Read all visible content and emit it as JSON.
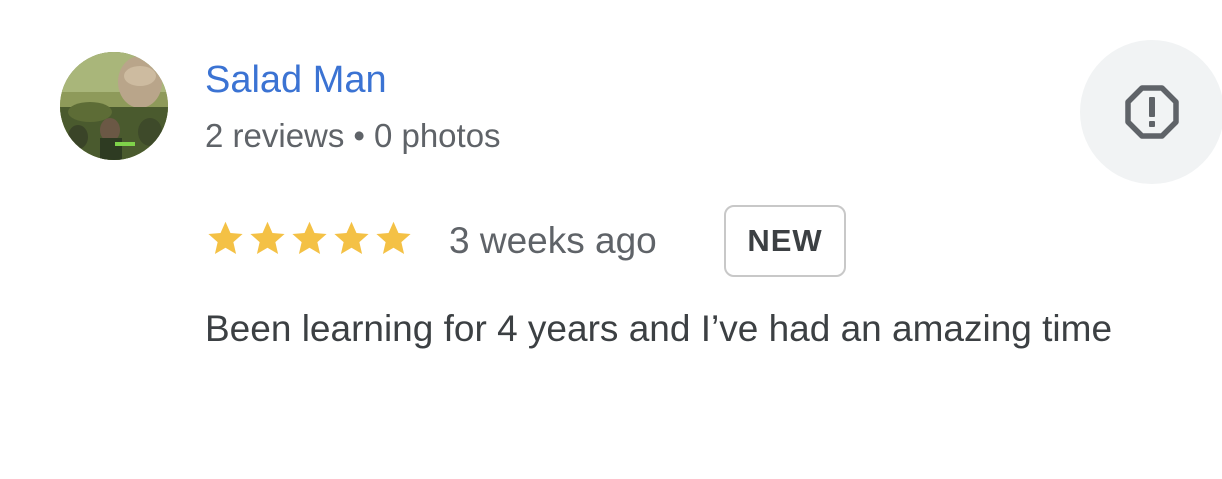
{
  "review": {
    "author": {
      "name": "Salad Man",
      "reviews_count": "2 reviews",
      "separator": "•",
      "photos_count": "0 photos"
    },
    "rating": 5,
    "max_rating": 5,
    "date": "3 weeks ago",
    "badge": "NEW",
    "text": "Been learning for 4 years and I’ve had an amazing time",
    "report_icon": "report-octagon-icon"
  },
  "colors": {
    "author_name": "#3b73d3",
    "star": "#f4c145",
    "secondary_text": "#5f6368",
    "body_text": "#3c4043",
    "report_bg": "#f1f3f4"
  }
}
